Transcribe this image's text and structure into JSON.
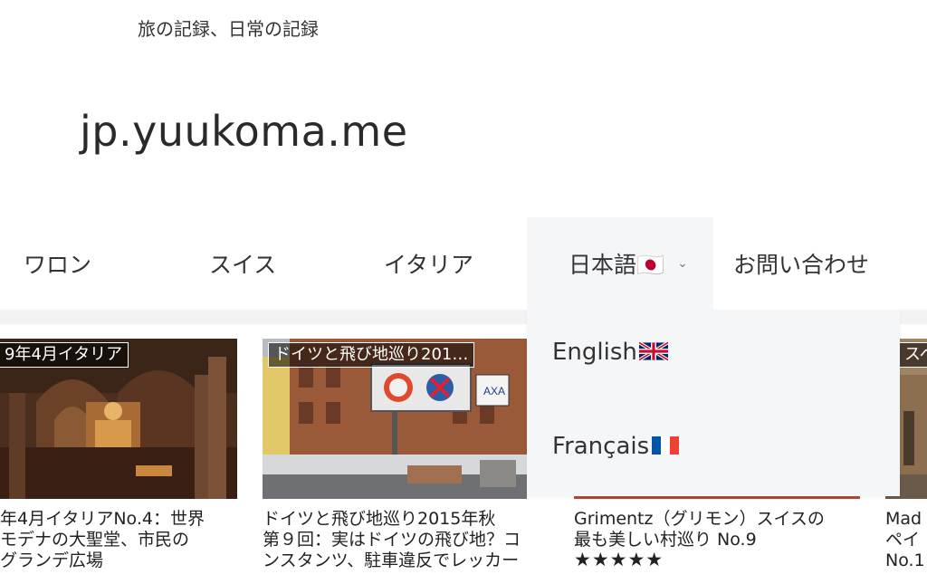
{
  "header": {
    "tagline": "旅の記録、日常の記録",
    "site_title": "jp.yuukoma.me"
  },
  "nav": {
    "items": [
      "ワロン",
      "スイス",
      "イタリア",
      "日本語🇯🇵",
      "お問い合わせ"
    ],
    "chevron": "⌄"
  },
  "language_menu": {
    "items": [
      {
        "label": "English",
        "flag": "uk-flag-icon"
      },
      {
        "label": "Français",
        "flag": "france-flag-icon"
      }
    ]
  },
  "cards": [
    {
      "category": "9年4月イタリア",
      "title_lines": [
        "年4月イタリアNo.4：世界",
        "モデナの大聖堂、市民の",
        "グランデ広場"
      ]
    },
    {
      "category": "ドイツと飛び地巡り201…",
      "title_lines": [
        "ドイツと飛び地巡り2015年秋",
        "第９回：実はドイツの飛び地？コ",
        "ンスタンツ、駐車違反でレッカー"
      ]
    },
    {
      "category": "",
      "title_lines": [
        "Grimentz（グリモン）スイスの",
        "最も美しい村巡り No.9"
      ],
      "rating": "★★★★★"
    },
    {
      "category": "スペ",
      "title_lines": [
        "Mad",
        "ペイ",
        "No.1"
      ]
    }
  ],
  "colors": {
    "nav_active_bg": "#f5f6f8",
    "dropdown_bg": "#f5f6f8",
    "strip_bg": "#f3f3f4"
  }
}
